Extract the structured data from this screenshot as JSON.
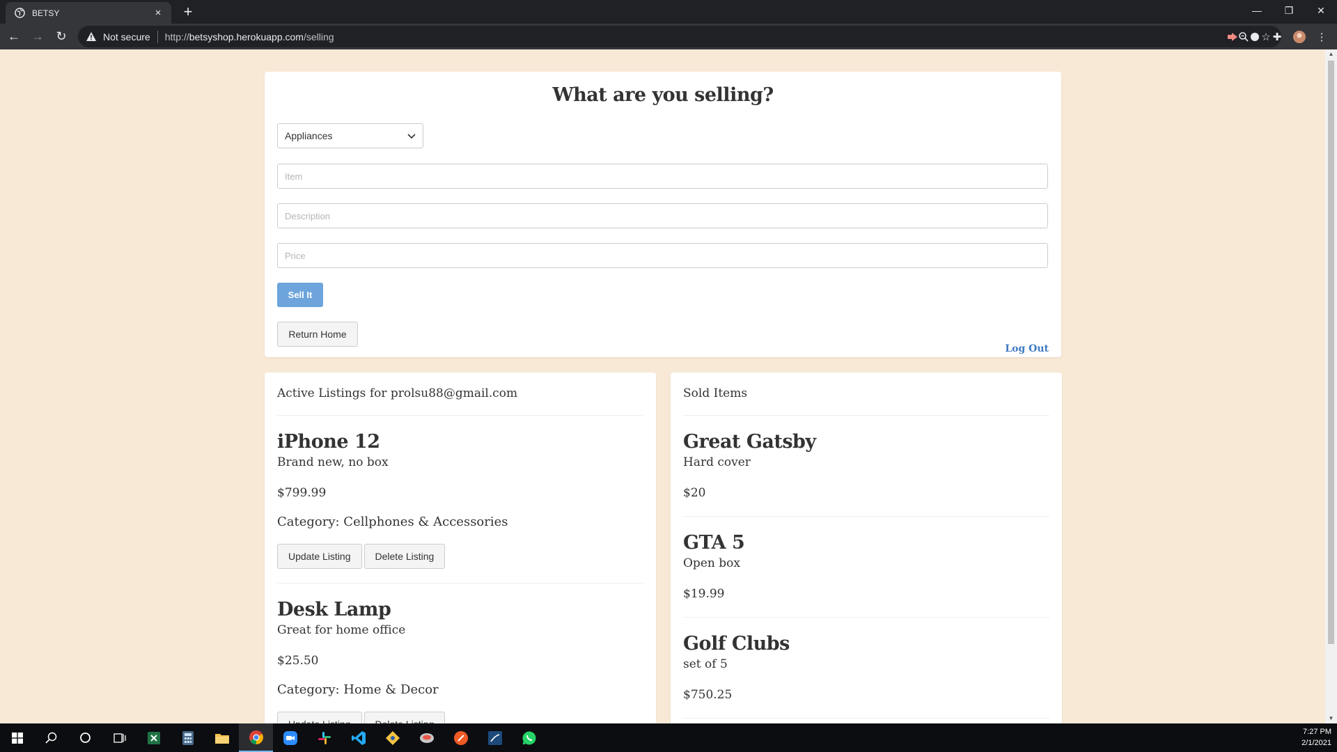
{
  "browser": {
    "tab_title": "BETSY",
    "tab_close": "×",
    "new_tab": "+",
    "security_label": "Not secure",
    "url_prefix": "http://",
    "url_host": "betsyshop.herokuapp.com",
    "url_path": "/selling"
  },
  "form": {
    "title": "What are you selling?",
    "category_selected": "Appliances",
    "item_placeholder": "Item",
    "description_placeholder": "Description",
    "price_placeholder": "Price",
    "sell_label": "Sell It",
    "return_label": "Return Home",
    "logout_label": "Log Out"
  },
  "active": {
    "heading": "Active Listings for prolsu88@gmail.com",
    "items": [
      {
        "name": "iPhone 12",
        "description": "Brand new, no box",
        "price": "$799.99",
        "category": "Category: Cellphones & Accessories",
        "update_label": "Update Listing",
        "delete_label": "Delete Listing"
      },
      {
        "name": "Desk Lamp",
        "description": "Great for home office",
        "price": "$25.50",
        "category": "Category: Home & Decor",
        "update_label": "Update Listing",
        "delete_label": "Delete Listing"
      }
    ]
  },
  "sold": {
    "heading": "Sold Items",
    "items": [
      {
        "name": "Great Gatsby",
        "description": "Hard cover",
        "price": "$20"
      },
      {
        "name": "GTA 5",
        "description": "Open box",
        "price": "$19.99"
      },
      {
        "name": "Golf Clubs",
        "description": "set of 5",
        "price": "$750.25"
      }
    ]
  },
  "taskbar": {
    "time": "7:27 PM",
    "date": "2/1/2021"
  },
  "colors": {
    "page_background": "#f8e9d6",
    "sell_button": "#6ca4db",
    "logout_link": "#3f7ac2"
  }
}
